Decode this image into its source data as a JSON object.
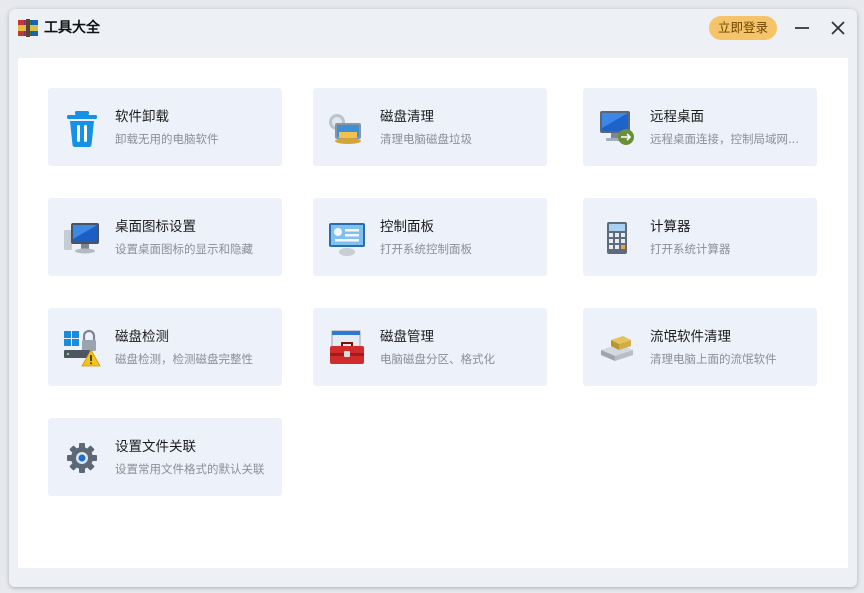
{
  "app": {
    "title": "工具大全",
    "login_label": "立即登录"
  },
  "accent_colors": {
    "login_button": "#f5c46a",
    "card_background": "#ecf1fa"
  },
  "tools": [
    {
      "title": "软件卸载",
      "desc": "卸载无用的电脑软件",
      "icon": "trash-icon"
    },
    {
      "title": "磁盘清理",
      "desc": "清理电脑磁盘垃圾",
      "icon": "disk-cleanup-icon"
    },
    {
      "title": "远程桌面",
      "desc": "远程桌面连接，控制局域网...",
      "icon": "remote-desktop-icon"
    },
    {
      "title": "桌面图标设置",
      "desc": "设置桌面图标的显示和隐藏",
      "icon": "desktop-computer-icon"
    },
    {
      "title": "控制面板",
      "desc": "打开系统控制面板",
      "icon": "control-panel-icon"
    },
    {
      "title": "计算器",
      "desc": "打开系统计算器",
      "icon": "calculator-icon"
    },
    {
      "title": "磁盘检测",
      "desc": "磁盘检测，检测磁盘完整性",
      "icon": "disk-check-icon"
    },
    {
      "title": "磁盘管理",
      "desc": "电脑磁盘分区、格式化",
      "icon": "toolbox-icon"
    },
    {
      "title": "流氓软件清理",
      "desc": "清理电脑上面的流氓软件",
      "icon": "malware-cleanup-icon"
    },
    {
      "title": "设置文件关联",
      "desc": "设置常用文件格式的默认关联",
      "icon": "gear-icon"
    }
  ]
}
